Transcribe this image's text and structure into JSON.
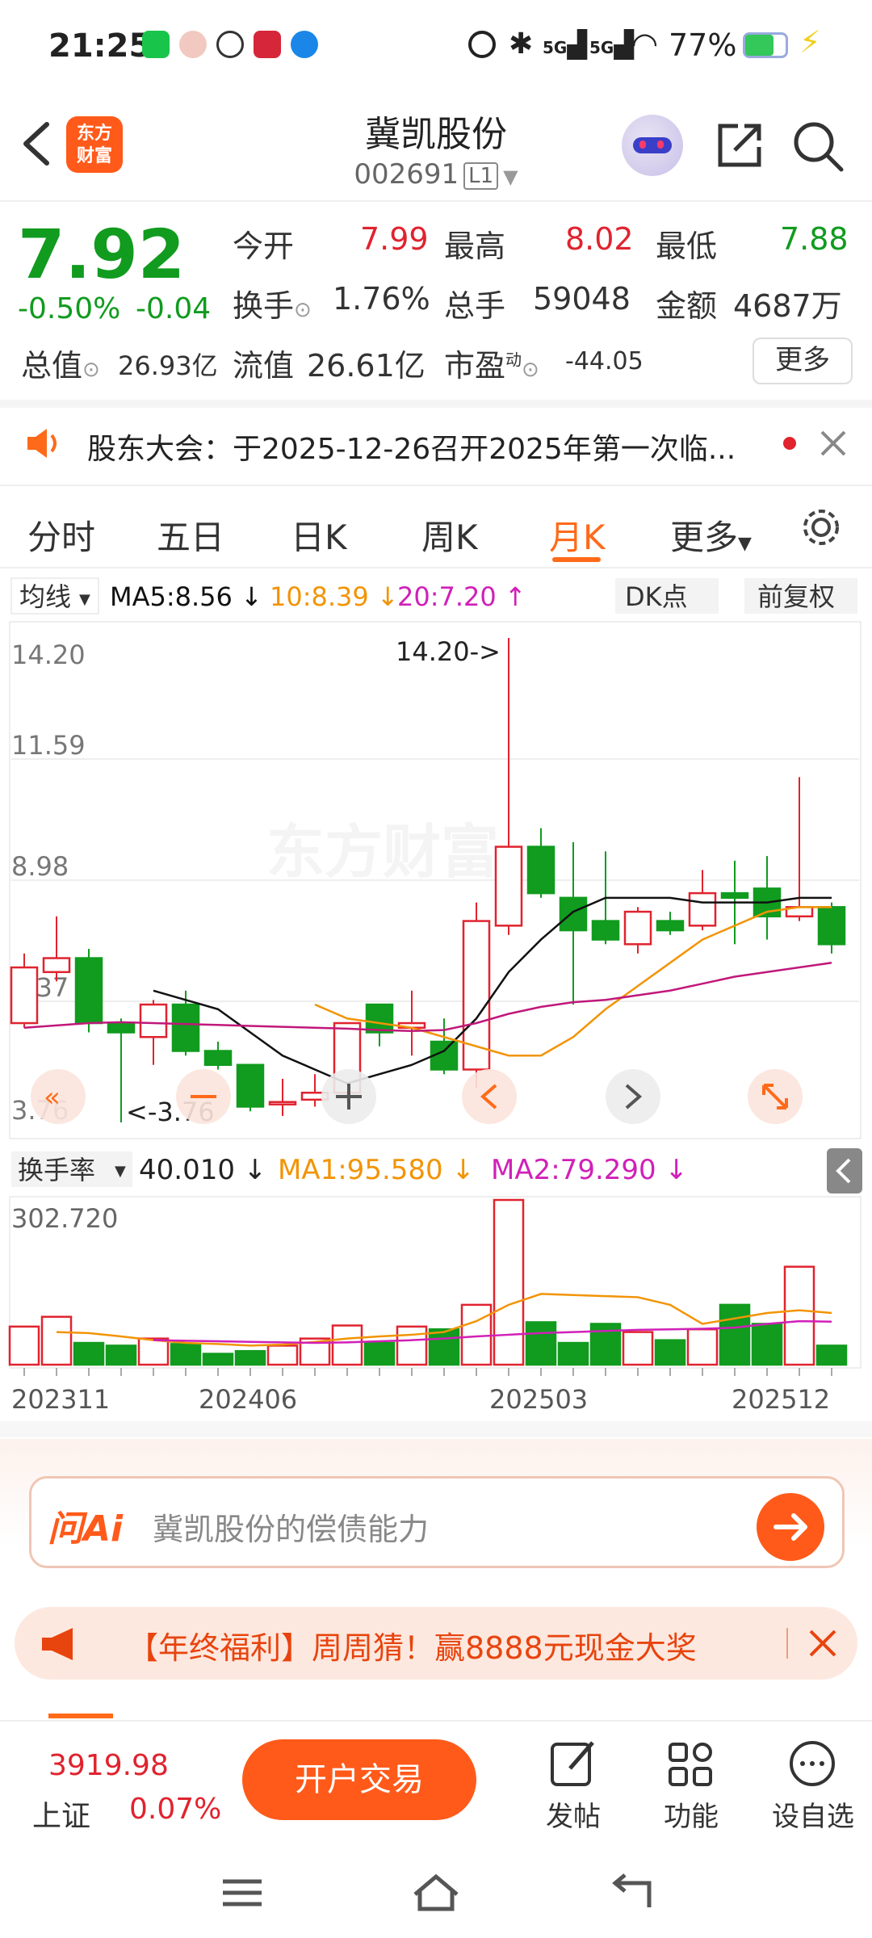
{
  "status_bar": {
    "time": "21:25",
    "network_1": "5G",
    "network_2": "5G",
    "battery": "77%"
  },
  "header": {
    "back_icon": "back-arrow-icon",
    "logo_text": "东方\n财富",
    "stock_name": "冀凯股份",
    "stock_code": "002691",
    "level": "L1",
    "share_icon": "share-icon",
    "search_icon": "search-icon"
  },
  "quote": {
    "price": "7.92",
    "change_pct": "-0.50%",
    "change_amt": "-0.04",
    "open_label": "今开",
    "open": "7.99",
    "high_label": "最高",
    "high": "8.02",
    "low_label": "最低",
    "low": "7.88",
    "turnover_label": "换手",
    "turnover": "1.76%",
    "volume_label": "总手",
    "volume": "59048",
    "amount_label": "金额",
    "amount": "4687万",
    "mktcap_label": "总值",
    "mktcap": "26.93亿",
    "float_label": "流值",
    "float_cap": "26.61亿",
    "pe_label": "市盈",
    "pe_sup": "动",
    "pe": "-44.05",
    "more_button": "更多"
  },
  "notice": {
    "text": "股东大会：于2025-12-26召开2025年第一次临..."
  },
  "tabs": [
    {
      "label": "分时",
      "active": false
    },
    {
      "label": "五日",
      "active": false
    },
    {
      "label": "日K",
      "active": false
    },
    {
      "label": "周K",
      "active": false
    },
    {
      "label": "月K",
      "active": true
    },
    {
      "label": "更多",
      "active": false
    }
  ],
  "indicator_bar": {
    "ma_select": "均线",
    "ma5": "MA5:8.56 ↓",
    "ma10": "10:8.39 ↓",
    "ma20": "20:7.20 ↑",
    "dk_button": "DK点",
    "adjust_button": "前复权"
  },
  "volume_bar": {
    "select": "换手率",
    "value": "40.010 ↓",
    "ma1": "MA1:95.580 ↓",
    "ma2": "MA2:79.290 ↓"
  },
  "chart_data": {
    "type": "candlestick",
    "period": "monthly",
    "y_ticks": [
      "14.20",
      "11.59",
      "8.98",
      "6.37",
      "3.76"
    ],
    "ylim": [
      3.76,
      14.2
    ],
    "max_label": "14.20->",
    "min_label": "<-3.76",
    "x_ticks": [
      "202311",
      "202406",
      "202503",
      "202512"
    ],
    "candles": [
      {
        "o": 5.9,
        "c": 7.1,
        "h": 7.4,
        "l": 5.8
      },
      {
        "o": 7.0,
        "c": 7.3,
        "h": 8.2,
        "l": 6.8
      },
      {
        "o": 7.3,
        "c": 5.9,
        "h": 7.5,
        "l": 5.7
      },
      {
        "o": 5.9,
        "c": 5.7,
        "h": 6.0,
        "l": 3.76
      },
      {
        "o": 5.6,
        "c": 6.3,
        "h": 6.4,
        "l": 5.0
      },
      {
        "o": 6.3,
        "c": 5.3,
        "h": 6.6,
        "l": 5.2
      },
      {
        "o": 5.3,
        "c": 5.0,
        "h": 5.5,
        "l": 4.9
      },
      {
        "o": 5.0,
        "c": 4.1,
        "h": 5.0,
        "l": 4.0
      },
      {
        "o": 4.15,
        "c": 4.2,
        "h": 4.7,
        "l": 3.9
      },
      {
        "o": 4.25,
        "c": 4.4,
        "h": 4.8,
        "l": 4.1
      },
      {
        "o": 4.4,
        "c": 5.9,
        "h": 5.9,
        "l": 4.2
      },
      {
        "o": 6.3,
        "c": 5.7,
        "h": 6.3,
        "l": 5.4
      },
      {
        "o": 5.8,
        "c": 5.9,
        "h": 6.6,
        "l": 5.2
      },
      {
        "o": 5.5,
        "c": 4.9,
        "h": 6.0,
        "l": 4.8
      },
      {
        "o": 4.9,
        "c": 8.1,
        "h": 8.5,
        "l": 4.5
      },
      {
        "o": 8.0,
        "c": 9.7,
        "h": 14.2,
        "l": 7.8
      },
      {
        "o": 9.7,
        "c": 8.7,
        "h": 10.1,
        "l": 8.6
      },
      {
        "o": 8.6,
        "c": 7.9,
        "h": 9.8,
        "l": 6.3
      },
      {
        "o": 8.1,
        "c": 7.7,
        "h": 9.6,
        "l": 7.6
      },
      {
        "o": 7.6,
        "c": 8.3,
        "h": 8.4,
        "l": 7.4
      },
      {
        "o": 8.1,
        "c": 7.9,
        "h": 8.3,
        "l": 7.8
      },
      {
        "o": 8.0,
        "c": 8.7,
        "h": 9.2,
        "l": 7.9
      },
      {
        "o": 8.7,
        "c": 8.6,
        "h": 9.4,
        "l": 7.6
      },
      {
        "o": 8.8,
        "c": 8.2,
        "h": 9.5,
        "l": 7.7
      },
      {
        "o": 8.2,
        "c": 8.4,
        "h": 11.2,
        "l": 8.1
      },
      {
        "o": 8.4,
        "c": 7.6,
        "h": 8.5,
        "l": 7.4
      }
    ],
    "series": [
      {
        "name": "MA5",
        "color": "#111111",
        "values": [
          null,
          null,
          null,
          null,
          6.6,
          6.4,
          6.2,
          5.7,
          5.2,
          4.9,
          4.6,
          4.8,
          5.0,
          5.3,
          6.0,
          7.0,
          7.7,
          8.3,
          8.6,
          8.6,
          8.6,
          8.5,
          8.5,
          8.5,
          8.6,
          8.6
        ]
      },
      {
        "name": "MA10",
        "color": "#f29406",
        "values": [
          null,
          null,
          null,
          null,
          null,
          null,
          null,
          null,
          null,
          6.3,
          6.0,
          5.9,
          5.8,
          5.6,
          5.4,
          5.2,
          5.2,
          5.6,
          6.2,
          6.7,
          7.2,
          7.7,
          8.0,
          8.3,
          8.4,
          8.4
        ]
      },
      {
        "name": "MA20",
        "color": "#c0187a",
        "values": [
          5.8,
          5.85,
          5.9,
          5.92,
          5.9,
          5.88,
          5.86,
          5.84,
          5.82,
          5.8,
          5.78,
          5.75,
          5.73,
          5.75,
          5.9,
          6.1,
          6.25,
          6.35,
          6.4,
          6.5,
          6.6,
          6.75,
          6.9,
          7.0,
          7.1,
          7.2
        ]
      }
    ],
    "turnover": {
      "ymax": 302.72,
      "ymax_label": "302.720",
      "bars": [
        70,
        88,
        40,
        35,
        48,
        38,
        20,
        25,
        35,
        48,
        72,
        40,
        70,
        65,
        110,
        302.72,
        78,
        40,
        75,
        60,
        45,
        65,
        110,
        75,
        180,
        35
      ],
      "ma1": [
        null,
        60,
        58,
        52,
        45,
        40,
        38,
        35,
        37,
        42,
        48,
        52,
        55,
        60,
        80,
        110,
        130,
        128,
        126,
        124,
        110,
        75,
        85,
        95,
        100,
        95
      ],
      "ma2": [
        null,
        null,
        null,
        null,
        45,
        44,
        43,
        42,
        41,
        40,
        41,
        43,
        45,
        48,
        52,
        55,
        58,
        60,
        62,
        64,
        65,
        66,
        68,
        75,
        80,
        79
      ]
    }
  },
  "chart_controls": {
    "rewind_icon": "double-left-icon",
    "zoom_out_icon": "minus-icon",
    "zoom_in_icon": "plus-icon",
    "prev_icon": "chevron-left-icon",
    "next_icon": "chevron-right-icon",
    "expand_icon": "expand-icon"
  },
  "watermark": "东方财富",
  "ask": {
    "brand": "问Ai",
    "placeholder": "冀凯股份的偿债能力"
  },
  "promo": {
    "text": "【年终福利】周周猜！赢8888元现金大奖"
  },
  "bottom_nav": {
    "index_value": "3919.98",
    "index_name": "上证",
    "index_change": "0.07%",
    "trade_button": "开户交易",
    "post_label": "发帖",
    "func_label": "功能",
    "watch_label": "设自选"
  },
  "colors": {
    "up": "#e0232f",
    "down": "#119b1f",
    "accent": "#ff6a1a",
    "ma5": "#111111",
    "ma10": "#f29406",
    "ma20": "#c0187a"
  }
}
